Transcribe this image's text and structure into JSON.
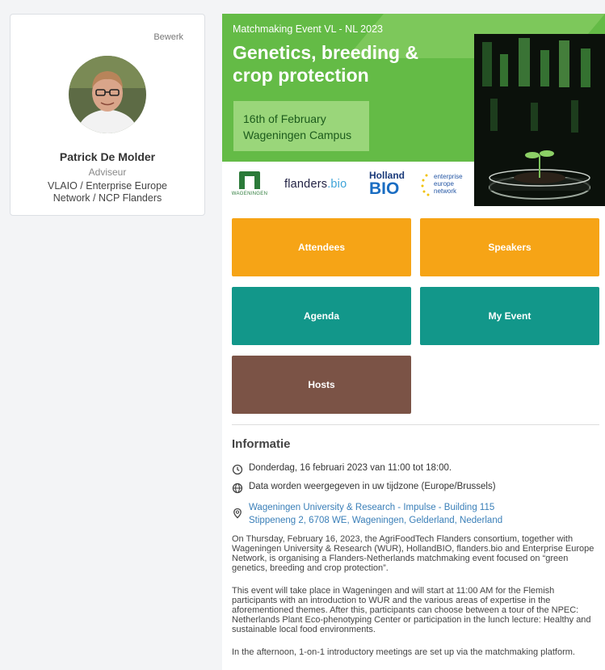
{
  "profile": {
    "edit_label": "Bewerk",
    "name": "Patrick De Molder",
    "role": "Adviseur",
    "org_line1": "VLAIO / Enterprise Europe",
    "org_line2": "Network / NCP Flanders"
  },
  "banner": {
    "kicker": "Matchmaking Event VL - NL 2023",
    "title_line1": "Genetics, breeding &",
    "title_line2": "crop protection",
    "date_line1": "16th of February",
    "date_line2": "Wageningen Campus",
    "logos": {
      "wur": "WAGENINGEN",
      "flanders_a": "flanders",
      "flanders_b": ".bio",
      "holland_1": "Holland",
      "holland_2": "BIO",
      "een_1": "enterprise",
      "een_2": "europe",
      "een_3": "network"
    }
  },
  "tiles": {
    "attendees": "Attendees",
    "speakers": "Speakers",
    "agenda": "Agenda",
    "my_event": "My Event",
    "hosts": "Hosts"
  },
  "colors": {
    "orange": "#f6a416",
    "teal": "#12978a",
    "brown": "#7b5346",
    "banner_green": "#64bb46",
    "link_blue": "#3a7fb8"
  },
  "info": {
    "heading": "Informatie",
    "datetime": "Donderdag, 16 februari 2023 van 11:00 tot 18:00.",
    "timezone": "Data worden weergegeven in uw tijdzone (Europe/Brussels)",
    "location_name": "Wageningen University & Research - Impulse - Building 115",
    "location_address": "Stippeneng 2, 6708 WE, Wageningen, Gelderland, Nederland",
    "para1": "On Thursday, February 16, 2023, the AgriFoodTech Flanders consortium, together with Wageningen University & Research (WUR), HollandBIO, flanders.bio and Enterprise Europe Network, is organising a Flanders-Netherlands matchmaking event focused on “green genetics, breeding and crop protection”.",
    "para2": "This event will take place in Wageningen and will start at 11:00 AM for the Flemish participants with an introduction to WUR and the various areas of expertise in the aforementioned themes. After this, participants can choose between a tour of the NPEC: Netherlands Plant Eco-phenotyping Center or participation in the lunch lecture: Healthy and sustainable local food environments.",
    "para3": "In the afternoon, 1-on-1 introductory meetings are set up via the matchmaking platform."
  },
  "icons": {
    "clock": "clock-icon",
    "globe": "globe-icon",
    "location": "map-pin-icon"
  }
}
